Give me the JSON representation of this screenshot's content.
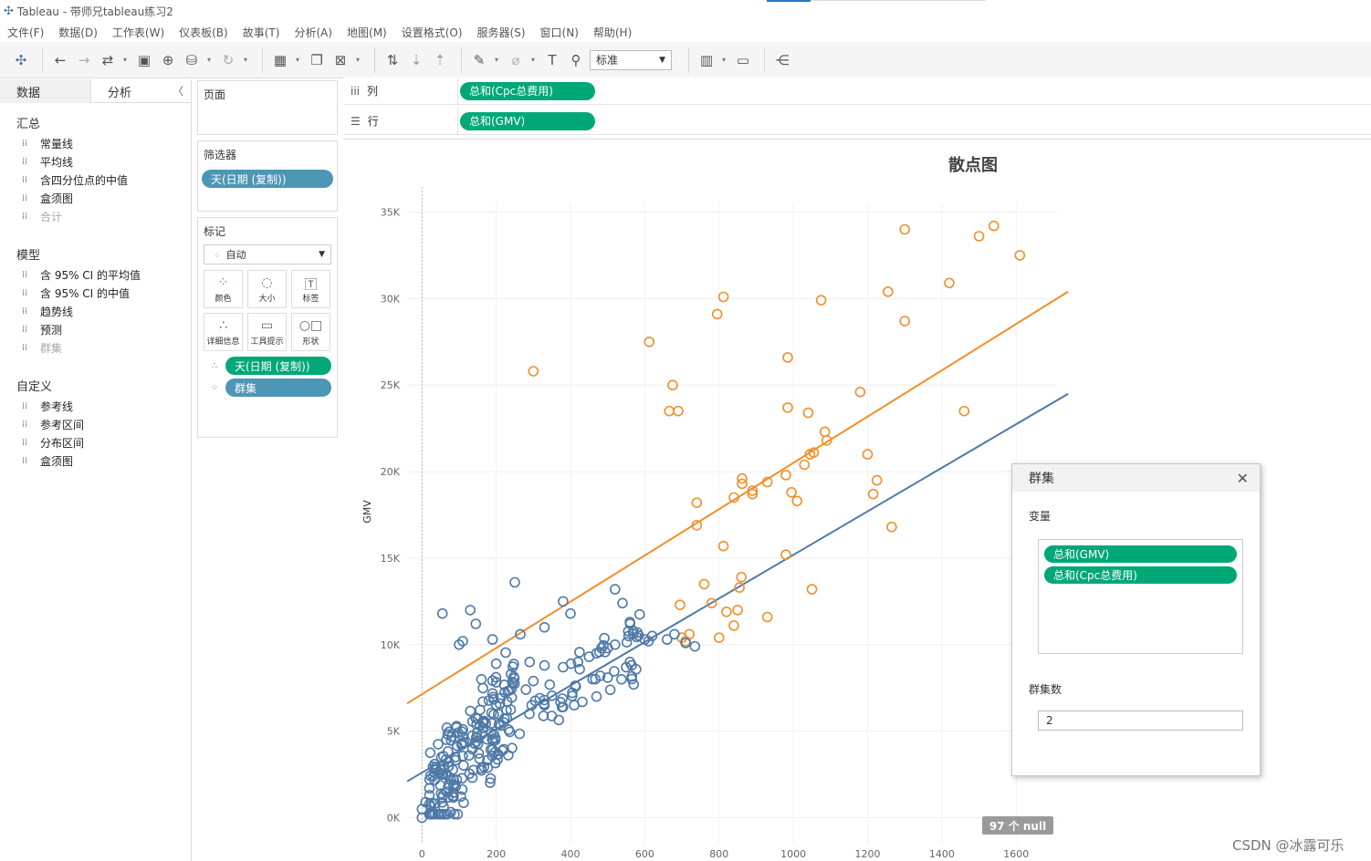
{
  "window": {
    "title": "Tableau - 带师兄tableau练习2"
  },
  "menu": [
    "文件(F)",
    "数据(D)",
    "工作表(W)",
    "仪表板(B)",
    "故事(T)",
    "分析(A)",
    "地图(M)",
    "设置格式(O)",
    "服务器(S)",
    "窗口(N)",
    "帮助(H)"
  ],
  "toolbar": {
    "view_select": "标准"
  },
  "left_pane": {
    "tabs": [
      "数据",
      "分析"
    ],
    "sections": [
      {
        "title": "汇总",
        "items": [
          {
            "label": "常量线",
            "dim": false
          },
          {
            "label": "平均线",
            "dim": false
          },
          {
            "label": "含四分位点的中值",
            "dim": false
          },
          {
            "label": "盒须图",
            "dim": false
          },
          {
            "label": "合计",
            "dim": true
          }
        ]
      },
      {
        "title": "模型",
        "items": [
          {
            "label": "含 95% CI 的平均值",
            "dim": false
          },
          {
            "label": "含 95% CI 的中值",
            "dim": false
          },
          {
            "label": "趋势线",
            "dim": false
          },
          {
            "label": "预测",
            "dim": false
          },
          {
            "label": "群集",
            "dim": true
          }
        ]
      },
      {
        "title": "自定义",
        "items": [
          {
            "label": "参考线",
            "dim": false
          },
          {
            "label": "参考区间",
            "dim": false
          },
          {
            "label": "分布区间",
            "dim": false
          },
          {
            "label": "盒须图",
            "dim": false
          }
        ]
      }
    ]
  },
  "cards": {
    "pages_title": "页面",
    "filters_title": "筛选器",
    "filter_pill": "天(日期 (复制))",
    "marks_title": "标记",
    "marks_type": "自动",
    "marks_buttons": [
      "颜色",
      "大小",
      "标签",
      "详细信息",
      "工具提示",
      "形状"
    ],
    "marks_pills": [
      "天(日期 (复制))",
      "群集"
    ]
  },
  "shelves": {
    "columns_label": "列",
    "columns_pill": "总和(Cpc总费用)",
    "rows_label": "行",
    "rows_pill": "总和(GMV)"
  },
  "chart_data": {
    "type": "scatter",
    "title": "散点图",
    "xlabel": "",
    "ylabel": "GMV",
    "xlim": [
      -40,
      1710
    ],
    "ylim": [
      -1500,
      35500
    ],
    "x_ticks": [
      0,
      200,
      400,
      600,
      800,
      1000,
      1200,
      1400,
      1600
    ],
    "y_ticks": [
      0,
      5000,
      10000,
      15000,
      20000,
      25000,
      30000,
      35000
    ],
    "y_tick_labels": [
      "0K",
      "5K",
      "10K",
      "15K",
      "20K",
      "25K",
      "30K",
      "35K"
    ],
    "grid": true,
    "colors": {
      "cluster_1": "#4e79a7",
      "cluster_2": "#f28e2b"
    },
    "trend_lines": [
      {
        "cluster": "cluster_2",
        "x": [
          -40,
          1740
        ],
        "y": [
          6600,
          30400
        ]
      },
      {
        "cluster": "cluster_1",
        "x": [
          -40,
          1740
        ],
        "y": [
          2100,
          24500
        ]
      }
    ],
    "null_count_label": "97 个 null"
  },
  "cluster_dialog": {
    "title": "群集",
    "variables_label": "变量",
    "variables": [
      "总和(GMV)",
      "总和(Cpc总费用)"
    ],
    "count_label": "群集数",
    "count_value": "2"
  },
  "watermark": "CSDN @冰露可乐"
}
